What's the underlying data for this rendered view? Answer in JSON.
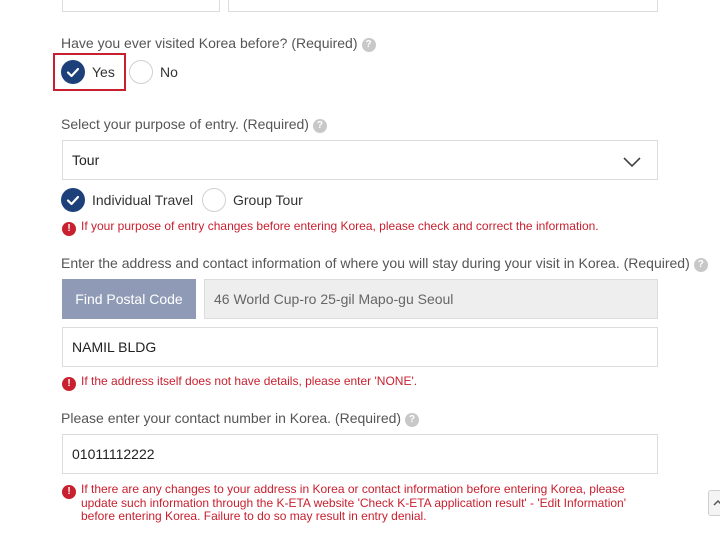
{
  "visit_question": {
    "label": "Have you ever visited Korea before? (Required)",
    "help": "?",
    "options": [
      {
        "label": "Yes",
        "selected": true
      },
      {
        "label": "No",
        "selected": false
      }
    ]
  },
  "purpose": {
    "label": "Select your purpose of entry. (Required)",
    "help": "?",
    "selected": "Tour",
    "travel_types": [
      {
        "label": "Individual Travel",
        "selected": true
      },
      {
        "label": "Group Tour",
        "selected": false
      }
    ],
    "error": "If your purpose of entry changes before entering Korea, please check and correct the information."
  },
  "address": {
    "label": "Enter the address and contact information of where you will stay during your visit in Korea. (Required)",
    "help": "?",
    "find_postal_code_label": "Find Postal Code",
    "address_value": "46 World Cup-ro 25-gil Mapo-gu Seoul",
    "detail_value": "NAMIL BLDG",
    "error": "If the address itself does not have details, please enter 'NONE'."
  },
  "contact": {
    "label": "Please enter your contact number in Korea. (Required)",
    "help": "?",
    "value": "01011112222",
    "error": "If there are any changes to your address in Korea or contact information before entering Korea, please update such information through the K-ETA website 'Check K-ETA application result' - 'Edit Information' before entering Korea. Failure to do so may result in entry denial."
  },
  "icons": {
    "error": "!",
    "check": "checkmark-icon",
    "dropdown": "chevron-down-icon",
    "scroll_top": "chevron-up-icon"
  },
  "colors": {
    "radio_checked": "#1d3f7a",
    "error": "#c8202f",
    "button": "#8f9bb6",
    "highlight": "#c8202f"
  }
}
